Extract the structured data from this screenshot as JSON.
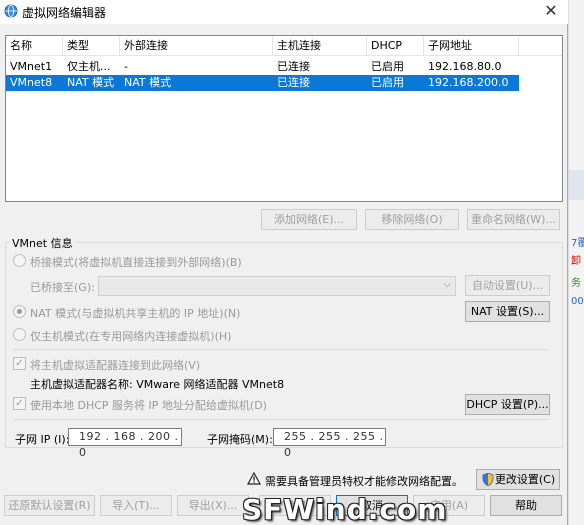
{
  "window": {
    "title": "虚拟网络编辑器",
    "close": "✕"
  },
  "columns": [
    "名称",
    "类型",
    "外部连接",
    "主机连接",
    "DHCP",
    "子网地址"
  ],
  "networks": [
    {
      "name": "VMnet1",
      "type": "仅主机...",
      "external": "-",
      "host": "已连接",
      "dhcp": "已启用",
      "subnet": "192.168.80.0",
      "selected": false
    },
    {
      "name": "VMnet8",
      "type": "NAT 模式",
      "external": "NAT 模式",
      "host": "已连接",
      "dhcp": "已启用",
      "subnet": "192.168.200.0",
      "selected": true
    }
  ],
  "list_buttons": {
    "add": "添加网络(E)...",
    "remove": "移除网络(O)",
    "rename": "重命名网络(W)..."
  },
  "vmnet_info": {
    "label": "VMnet 信息",
    "bridged": "桥接模式(将虚拟机直接连接到外部网络)(B)",
    "bridged_to_label": "已桥接至(G):",
    "bridged_to_value": "",
    "auto_settings": "自动设置(U)...",
    "nat": "NAT 模式(与虚拟机共享主机的 IP 地址)(N)",
    "nat_settings": "NAT 设置(S)...",
    "hostonly": "仅主机模式(在专用网络内连接虚拟机)(H)",
    "connect_adapter": "将主机虚拟适配器连接到此网络(V)",
    "adapter_name": "主机虚拟适配器名称: VMware 网络适配器 VMnet8",
    "use_dhcp": "使用本地 DHCP 服务将 IP 地址分配给虚拟机(D)",
    "dhcp_settings": "DHCP 设置(P)...",
    "subnet_ip_label": "子网 IP (I):",
    "subnet_ip": "192 . 168 . 200 . 0",
    "subnet_mask_label": "子网掩码(M):",
    "subnet_mask": "255 . 255 . 255 . 0",
    "selected_mode": "nat"
  },
  "admin_notice": "需要具备管理员特权才能修改网络配置。",
  "change_settings": "更改设置(C)",
  "bottom_buttons": {
    "restore": "还原默认设置(R)",
    "import": "导入(T)...",
    "export": "导出(X)...",
    "ok": "确定",
    "cancel": "取消",
    "apply": "应用(A)",
    "help": "帮助"
  },
  "watermark": "SFWind.com",
  "background_text": [
    "7覆",
    "卸",
    "务",
    "00"
  ],
  "colors": {
    "selection": "#0a78d7",
    "dialog_bg": "#f0f0f0",
    "primary_border": "#0078d7"
  }
}
